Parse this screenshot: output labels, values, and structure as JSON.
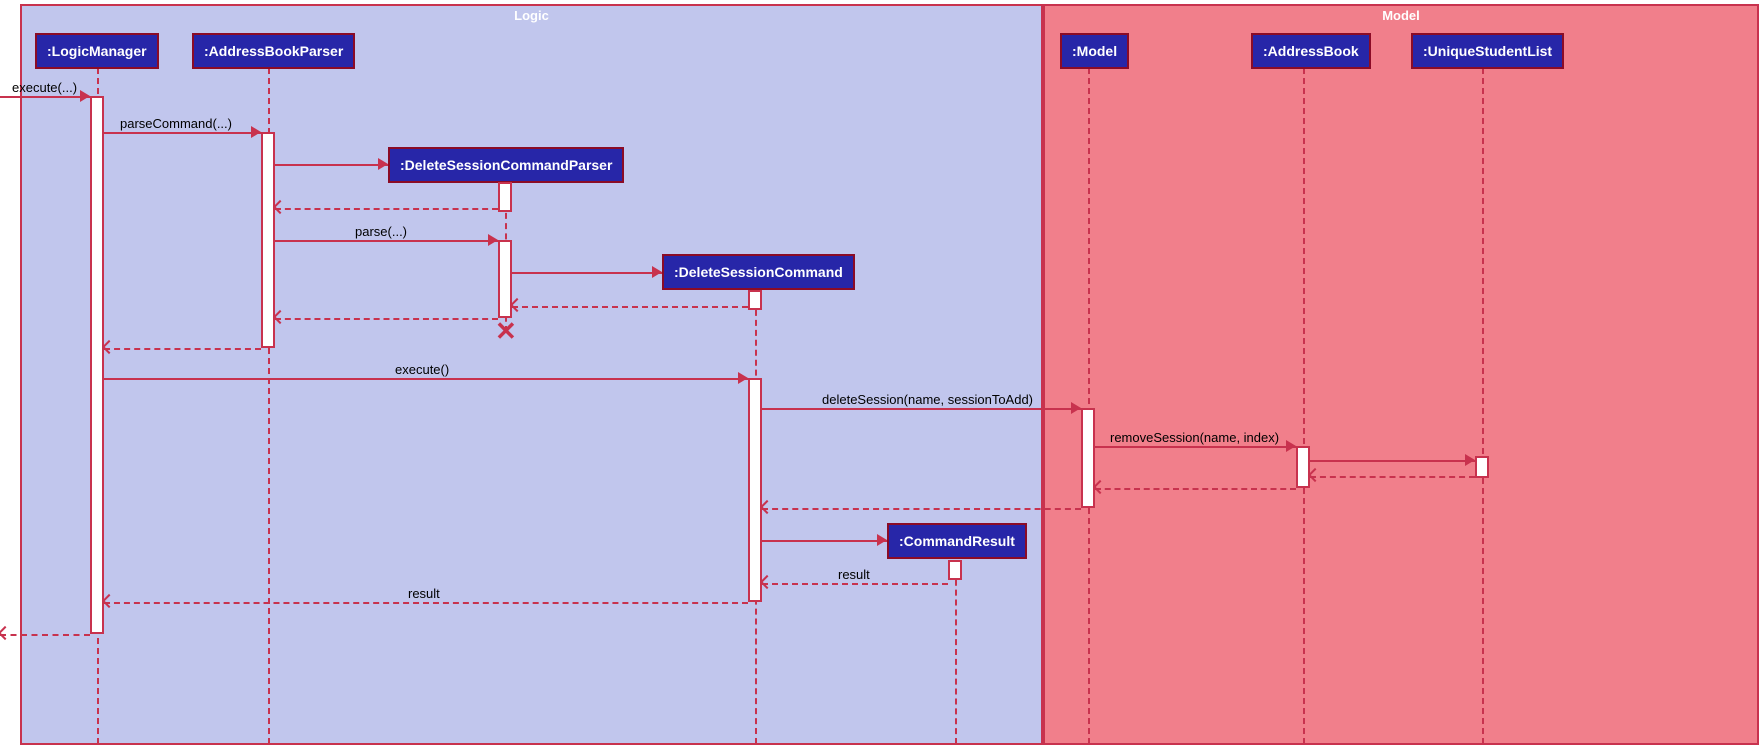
{
  "regions": {
    "logic": "Logic",
    "model": "Model"
  },
  "participants": {
    "logicManager": ":LogicManager",
    "addressBookParser": ":AddressBookParser",
    "deleteSessionCommandParser": ":DeleteSessionCommandParser",
    "deleteSessionCommand": ":DeleteSessionCommand",
    "commandResult": ":CommandResult",
    "model": ":Model",
    "addressBook": ":AddressBook",
    "uniqueStudentList": ":UniqueStudentList"
  },
  "messages": {
    "executeIn": "execute(...)",
    "parseCommand": "parseCommand(...)",
    "parse": "parse(...)",
    "execute": "execute()",
    "deleteSession": "deleteSession(name, sessionToAdd)",
    "removeSession": "removeSession(name, index)",
    "result1": "result",
    "result2": "result"
  }
}
